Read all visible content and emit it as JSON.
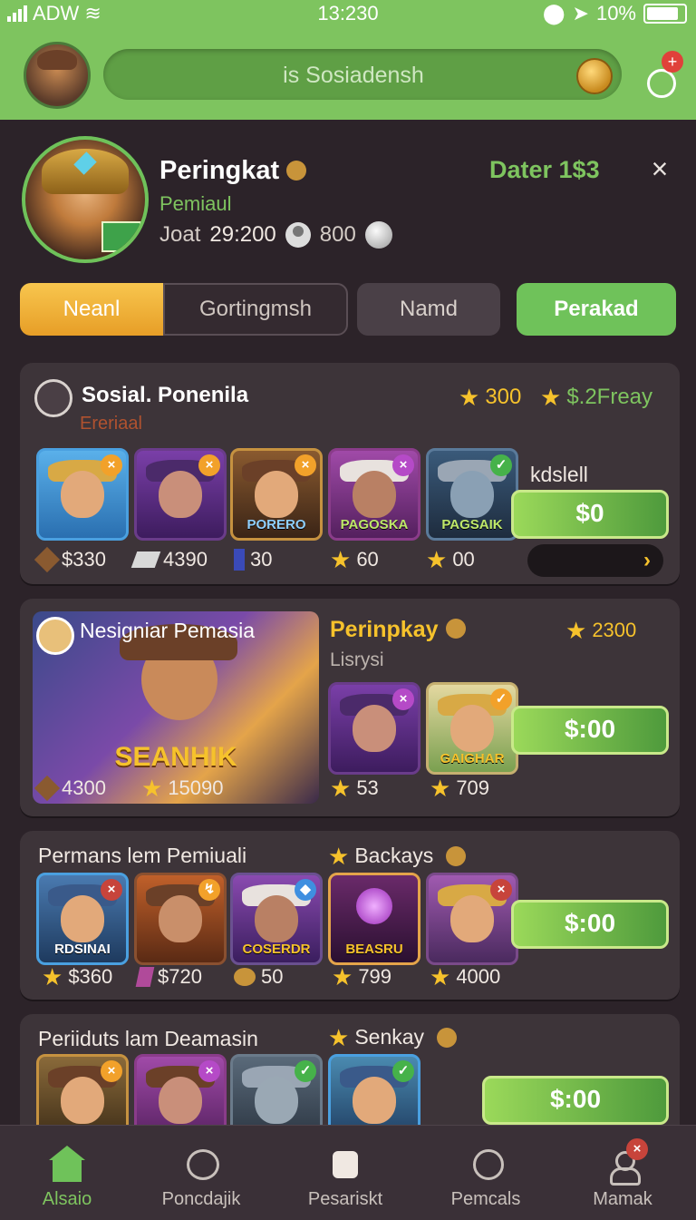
{
  "status": {
    "carrier": "ADW",
    "time": "13:230",
    "battery": "10%"
  },
  "header": {
    "search_placeholder": "is Sosiadensh"
  },
  "profile": {
    "title": "Peringkat",
    "subtitle": "Pemiaul",
    "stat_label": "Joat",
    "stat_value": "29:200",
    "coins": "800",
    "right_label": "Dater 1$3",
    "close": "×"
  },
  "tabs": [
    "Neanl",
    "Gortingmsh",
    "Namd",
    "Perakad"
  ],
  "card1": {
    "title": "Sosial. Ponenila",
    "subtitle": "Ereriaal",
    "stars1": "300",
    "stars2": "$.2Freay",
    "side_label": "kdslell",
    "button": "$0",
    "tiles": [
      {
        "label": ""
      },
      {
        "label": ""
      },
      {
        "label": "PORERO"
      },
      {
        "label": "PAGOSKA"
      },
      {
        "label": "PAGSAIK"
      }
    ],
    "stats": [
      "$330",
      "4390",
      "30",
      "60",
      "00"
    ]
  },
  "card2": {
    "title": "Nesigniar Pemasia",
    "banner": "SEANHIK",
    "banner_stats": [
      "4300",
      "15090"
    ],
    "heading": "Perinpkay",
    "sub": "Lisrysi",
    "stars": "2300",
    "button": "$:00",
    "tiles": [
      {
        "label": ""
      },
      {
        "label": "GAIGHAR"
      }
    ],
    "stats": [
      "53",
      "709"
    ]
  },
  "card3": {
    "title": "Permans lem Pemiuali",
    "heading": "Backays",
    "button": "$:00",
    "tiles": [
      {
        "label": "RDSINAI"
      },
      {
        "label": ""
      },
      {
        "label": "COSERDR"
      },
      {
        "label": "BEASRU"
      },
      {
        "label": ""
      }
    ],
    "stats": [
      "$360",
      "$720",
      "50",
      "799",
      "4000"
    ]
  },
  "card4": {
    "title": "Periiduts lam Deamasin",
    "heading": "Senkay",
    "button": "$:00"
  },
  "nav": [
    "Alsaio",
    "Poncdajik",
    "Pesariskt",
    "Pemcals",
    "Mamak"
  ]
}
